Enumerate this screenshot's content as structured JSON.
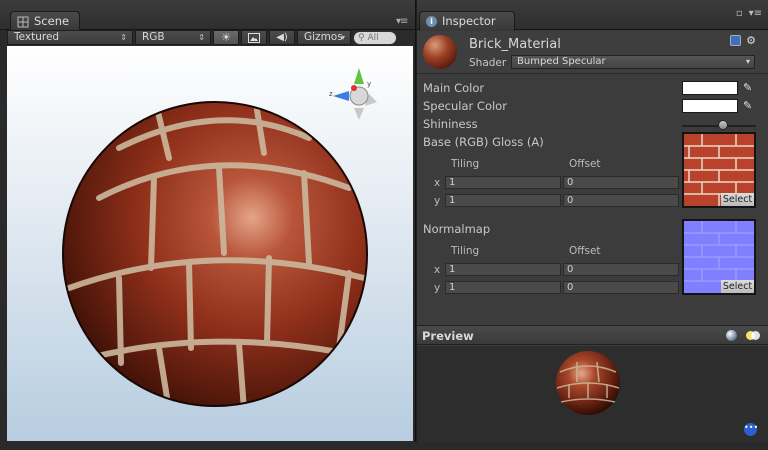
{
  "scene": {
    "tab_label": "Scene",
    "shading_mode": "Textured",
    "channel": "RGB",
    "gizmos_label": "Gizmos",
    "search_placeholder": "All",
    "icons": [
      "sun-icon",
      "image-icon",
      "audio-icon",
      "search-icon",
      "tab-menu-icon"
    ]
  },
  "inspector": {
    "tab_label": "Inspector",
    "material": {
      "name": "Brick_Material",
      "shader_label": "Shader",
      "shader_value": "Bumped Specular"
    },
    "properties": {
      "main_color_label": "Main Color",
      "specular_color_label": "Specular Color",
      "shininess_label": "Shininess",
      "shininess_value": 0.55,
      "base_label": "Base (RGB) Gloss (A)",
      "normalmap_label": "Normalmap",
      "tiling_label": "Tiling",
      "offset_label": "Offset",
      "x_label": "x",
      "y_label": "y",
      "base_tiling_x": "1",
      "base_tiling_y": "1",
      "base_offset_x": "0",
      "base_offset_y": "0",
      "normal_tiling_x": "1",
      "normal_tiling_y": "1",
      "normal_offset_x": "0",
      "normal_offset_y": "0",
      "select_label": "Select"
    },
    "preview_label": "Preview"
  },
  "colors": {
    "main_color": "#ffffff",
    "specular_color": "#ffffff",
    "brick": "#a13f24",
    "mortar": "#c9b7a0",
    "normalmap": "#7f7fff"
  }
}
